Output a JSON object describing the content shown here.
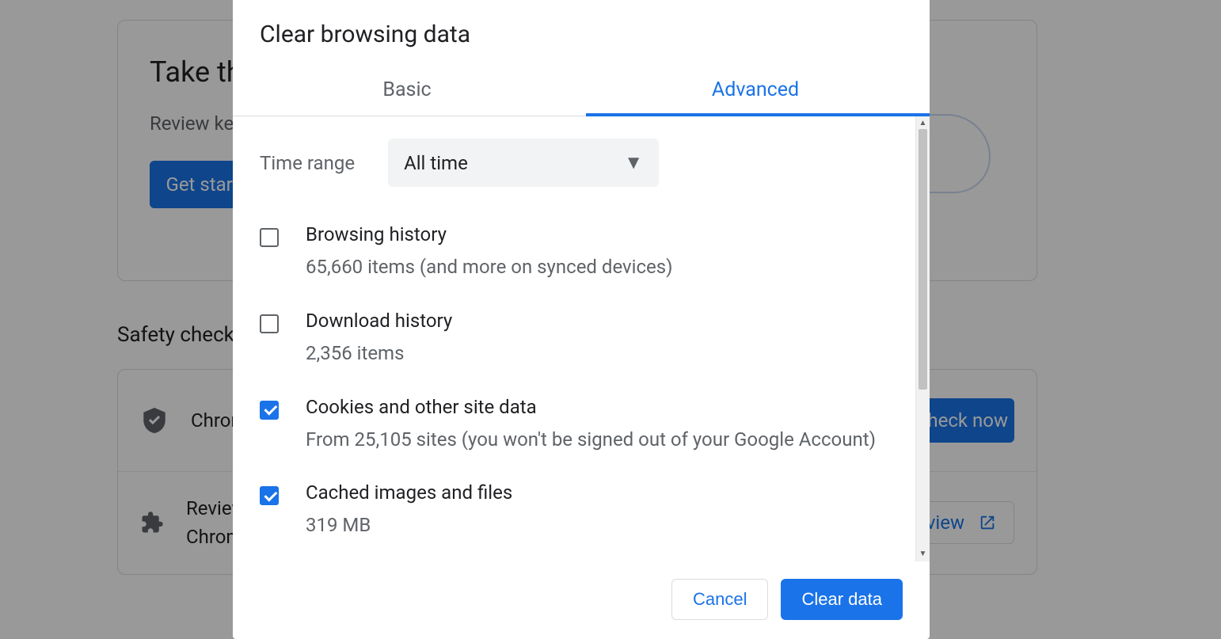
{
  "background": {
    "card1_title": "Take the Privacy Guide",
    "card1_sub": "Review key privacy and security controls in Chrome",
    "get_started": "Get started",
    "safety_heading": "Safety check",
    "row1_text": "Chrome can help keep you safe from data breaches, bad extensions, and more",
    "check_now": "Check now",
    "row2_text": "Review extensions you haven't used in a while or that were removed from the Chrome Web Store",
    "review_label": "Review"
  },
  "dialog": {
    "title": "Clear browsing data",
    "tabs": {
      "basic": "Basic",
      "advanced": "Advanced"
    },
    "time_label": "Time range",
    "time_value": "All time",
    "options": [
      {
        "checked": false,
        "title": "Browsing history",
        "sub": "65,660 items (and more on synced devices)"
      },
      {
        "checked": false,
        "title": "Download history",
        "sub": "2,356 items"
      },
      {
        "checked": true,
        "title": "Cookies and other site data",
        "sub": "From 25,105 sites (you won't be signed out of your Google Account)"
      },
      {
        "checked": true,
        "title": "Cached images and files",
        "sub": "319 MB"
      }
    ],
    "cancel": "Cancel",
    "clear": "Clear data"
  }
}
